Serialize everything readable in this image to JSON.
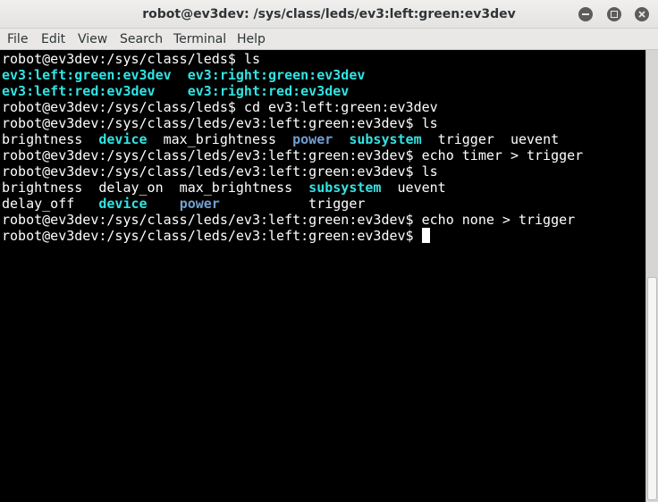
{
  "window": {
    "title": "robot@ev3dev: /sys/class/leds/ev3:left:green:ev3dev",
    "controls": {
      "minimize_icon": "minimize-icon",
      "maximize_icon": "maximize-icon",
      "close_icon": "close-icon"
    }
  },
  "menu": {
    "items": [
      "File",
      "Edit",
      "View",
      "Search",
      "Terminal",
      "Help"
    ]
  },
  "colors": {
    "background": "#000000",
    "text": "#ffffff",
    "directory": "#34e2e2",
    "symlink": "#729fcf"
  },
  "terminal": {
    "lines": [
      {
        "segments": [
          {
            "text": "robot@ev3dev:/sys/class/leds$ ls",
            "kind": "plain"
          }
        ]
      },
      {
        "segments": [
          {
            "text": "ev3:left:green:ev3dev",
            "kind": "dir"
          },
          {
            "text": "  ",
            "kind": "plain"
          },
          {
            "text": "ev3:right:green:ev3dev",
            "kind": "dir"
          }
        ]
      },
      {
        "segments": [
          {
            "text": "ev3:left:red:ev3dev",
            "kind": "dir"
          },
          {
            "text": "    ",
            "kind": "plain"
          },
          {
            "text": "ev3:right:red:ev3dev",
            "kind": "dir"
          }
        ]
      },
      {
        "segments": [
          {
            "text": "robot@ev3dev:/sys/class/leds$ cd ev3:left:green:ev3dev",
            "kind": "plain"
          }
        ]
      },
      {
        "segments": [
          {
            "text": "robot@ev3dev:/sys/class/leds/ev3:left:green:ev3dev$ ls",
            "kind": "plain"
          }
        ]
      },
      {
        "segments": [
          {
            "text": "brightness  ",
            "kind": "plain"
          },
          {
            "text": "device",
            "kind": "dir"
          },
          {
            "text": "  max_brightness  ",
            "kind": "plain"
          },
          {
            "text": "power",
            "kind": "link"
          },
          {
            "text": "  ",
            "kind": "plain"
          },
          {
            "text": "subsystem",
            "kind": "dir"
          },
          {
            "text": "  trigger  uevent",
            "kind": "plain"
          }
        ]
      },
      {
        "segments": [
          {
            "text": "robot@ev3dev:/sys/class/leds/ev3:left:green:ev3dev$ echo timer > trigger",
            "kind": "plain"
          }
        ]
      },
      {
        "segments": [
          {
            "text": "robot@ev3dev:/sys/class/leds/ev3:left:green:ev3dev$ ls",
            "kind": "plain"
          }
        ]
      },
      {
        "segments": [
          {
            "text": "brightness  delay_on  max_brightness  ",
            "kind": "plain"
          },
          {
            "text": "subsystem",
            "kind": "dir"
          },
          {
            "text": "  uevent",
            "kind": "plain"
          }
        ]
      },
      {
        "segments": [
          {
            "text": "delay_off   ",
            "kind": "plain"
          },
          {
            "text": "device",
            "kind": "dir"
          },
          {
            "text": "    ",
            "kind": "plain"
          },
          {
            "text": "power",
            "kind": "link"
          },
          {
            "text": "           trigger",
            "kind": "plain"
          }
        ]
      },
      {
        "segments": [
          {
            "text": "robot@ev3dev:/sys/class/leds/ev3:left:green:ev3dev$ echo none > trigger",
            "kind": "plain"
          }
        ]
      },
      {
        "segments": [
          {
            "text": "robot@ev3dev:/sys/class/leds/ev3:left:green:ev3dev$ ",
            "kind": "plain"
          }
        ],
        "cursor": true
      }
    ]
  }
}
